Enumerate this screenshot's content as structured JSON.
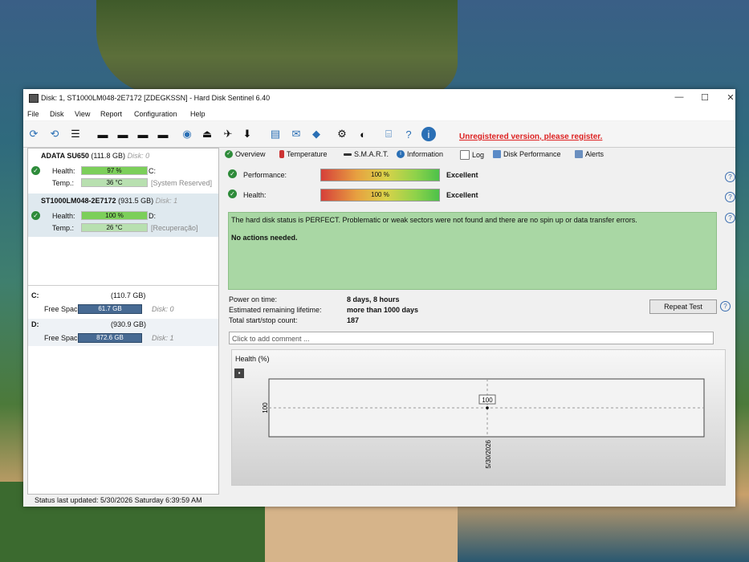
{
  "window": {
    "title": "Disk: 1, ST1000LM048-2E7172 [ZDEGKSSN]  -  Hard Disk Sentinel 6.40",
    "controls": {
      "minimize": "—",
      "maximize": "☐",
      "close": "✕"
    }
  },
  "menu": [
    "File",
    "Disk",
    "View",
    "Report",
    "Configuration",
    "Help"
  ],
  "toolbar": {
    "unregistered": "Unregistered version, please register."
  },
  "disks": [
    {
      "name": "ADATA SU650",
      "size": "(111.8 GB)",
      "index": "Disk: 0",
      "health_label": "Health:",
      "health": "97 %",
      "health_pct": 97,
      "drive": "C:",
      "temp_label": "Temp.:",
      "temp": "36 °C",
      "partition": "[System Reserved]"
    },
    {
      "name": "ST1000LM048-2E7172",
      "size": "(931.5 GB)",
      "index": "Disk: 1",
      "health_label": "Health:",
      "health": "100 %",
      "health_pct": 100,
      "drive": "D:",
      "temp_label": "Temp.:",
      "temp": "26 °C",
      "partition": "[Recuperação]"
    }
  ],
  "volumes": [
    {
      "letter": "C:",
      "size": "(110.7 GB)",
      "free_label": "Free Space",
      "free": "61.7 GB",
      "disk": "Disk: 0"
    },
    {
      "letter": "D:",
      "size": "(930.9 GB)",
      "free_label": "Free Space",
      "free": "872.6 GB",
      "disk": "Disk: 1"
    }
  ],
  "tabs": [
    "Overview",
    "Temperature",
    "S.M.A.R.T.",
    "Information",
    "Log",
    "Disk Performance",
    "Alerts"
  ],
  "performance": {
    "label": "Performance:",
    "value": "100 %",
    "rating": "Excellent"
  },
  "health": {
    "label": "Health:",
    "value": "100 %",
    "rating": "Excellent"
  },
  "status": {
    "message": "The hard disk status is PERFECT. Problematic or weak sectors were not found and there are no spin up or data transfer errors.",
    "action": "No actions needed."
  },
  "info": [
    {
      "label": "Power on time:",
      "value": "8 days, 8 hours"
    },
    {
      "label": "Estimated remaining lifetime:",
      "value": "more than 1000 days"
    },
    {
      "label": "Total start/stop count:",
      "value": "187"
    }
  ],
  "repeat_test": "Repeat Test",
  "comment_placeholder": "Click to add comment ...",
  "chart_data": {
    "type": "line",
    "title": "Health (%)",
    "x": [
      "5/30/2026"
    ],
    "series": [
      {
        "values": [
          100
        ]
      }
    ],
    "ytick": "100",
    "data_label": "100"
  },
  "statusbar": "Status last updated: 5/30/2026 Saturday 6:39:59 AM"
}
